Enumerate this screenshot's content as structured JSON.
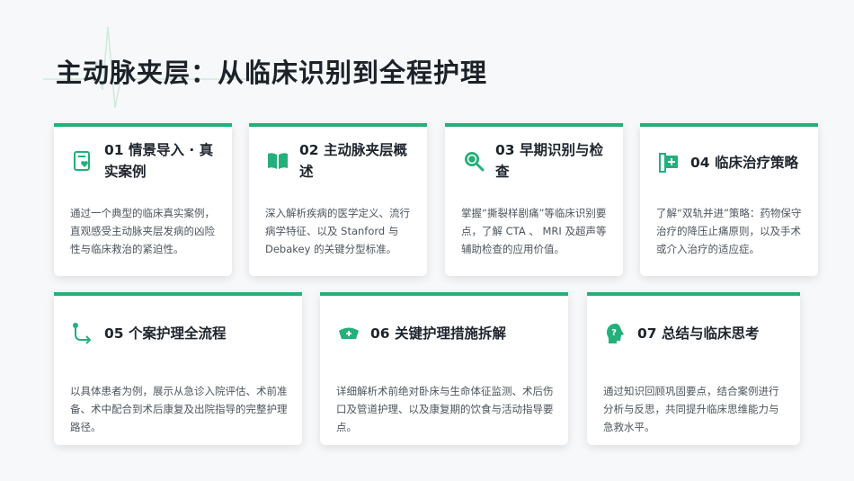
{
  "page": {
    "title": "主动脉夹层：从临床识别到全程护理"
  },
  "colors": {
    "accent": "#23b07a",
    "title": "#1c2229",
    "text": "#4d555d"
  },
  "cards": [
    {
      "title": "01  情景导入 · 真实案例",
      "icon": "heart-document-icon",
      "desc": "通过一个典型的临床真实案例，直观感受主动脉夹层发病的凶险性与临床救治的紧迫性。"
    },
    {
      "title": "02  主动脉夹层概述",
      "icon": "open-book-icon",
      "desc": "深入解析疾病的医学定义、流行病学特征、以及 Stanford 与 Debakey 的关键分型标准。"
    },
    {
      "title": "03  早期识别与检查",
      "icon": "search-icon",
      "desc": "掌握“撕裂样剧痛”等临床识别要点，了解 CTA 、 MRI 及超声等辅助检查的应用价值。"
    },
    {
      "title": "04  临床治疗策略",
      "icon": "medical-chart-icon",
      "desc": "了解“双轨并进”策略：药物保守治疗的降压止痛原则，以及手术或介入治疗的适应症。"
    },
    {
      "title": "05  个案护理全流程",
      "icon": "route-icon",
      "desc": "以具体患者为例，展示从急诊入院评估、术前准备、术中配合到术后康复及出院指导的完整护理路径。"
    },
    {
      "title": "06  关键护理措施拆解",
      "icon": "nurse-cap-icon",
      "desc": "详细解析术前绝对卧床与生命体征监测、术后伤口及管道护理、以及康复期的饮食与活动指导要点。"
    },
    {
      "title": "07  总结与临床思考",
      "icon": "head-question-icon",
      "desc": "通过知识回顾巩固要点，结合案例进行分析与反思，共同提升临床思维能力与急救水平。"
    }
  ]
}
